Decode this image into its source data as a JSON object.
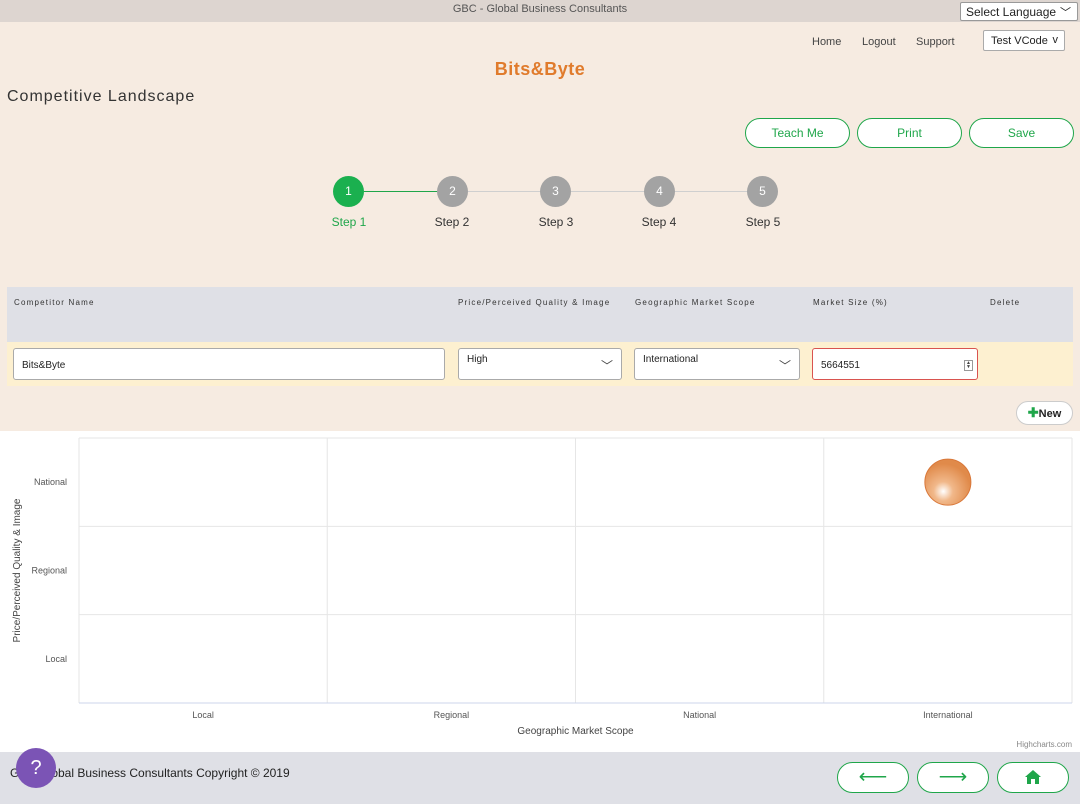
{
  "header": {
    "title": "GBC - Global Business Consultants",
    "language_select": "Select Language"
  },
  "nav": {
    "home": "Home",
    "logout": "Logout",
    "support": "Support",
    "vcode": "Test VCode",
    "vcode_chevron": "v"
  },
  "brand": "Bits&Byte",
  "page_title": "Competitive Landscape",
  "actions": {
    "teach_me": "Teach Me",
    "print": "Print",
    "save": "Save"
  },
  "steps": [
    {
      "number": "1",
      "label": "Step 1",
      "active": true
    },
    {
      "number": "2",
      "label": "Step 2",
      "active": false
    },
    {
      "number": "3",
      "label": "Step 3",
      "active": false
    },
    {
      "number": "4",
      "label": "Step 4",
      "active": false
    },
    {
      "number": "5",
      "label": "Step 5",
      "active": false
    }
  ],
  "table": {
    "headers": {
      "competitor_name": "Competitor Name",
      "price_quality": "Price/Perceived Quality & Image",
      "geo_scope": "Geographic Market Scope",
      "market_size": "Market Size (%)",
      "delete": "Delete"
    },
    "rows": [
      {
        "competitor_name": "Bits&Byte",
        "price_quality": "High",
        "geo_scope": "International",
        "market_size": "5664551"
      }
    ]
  },
  "new_button": "New",
  "chart_data": {
    "type": "bubble",
    "xlabel": "Geographic Market Scope",
    "ylabel": "Price/Perceived Quality & Image",
    "x_categories": [
      "Local",
      "Regional",
      "National",
      "International"
    ],
    "y_categories": [
      "Local",
      "Regional",
      "National"
    ],
    "grid": true,
    "points": [
      {
        "x": "International",
        "y": "National",
        "color": "#e08a4a"
      }
    ],
    "credit": "Highcharts.com"
  },
  "footer": {
    "copyright": "GBC Global Business Consultants Copyright © 2019",
    "help": "?",
    "back_arrow": "⟵",
    "next_arrow": "⟶"
  },
  "colors": {
    "accent": "#1fa64a",
    "brand": "#e07b2c",
    "help": "#7b54b5"
  }
}
